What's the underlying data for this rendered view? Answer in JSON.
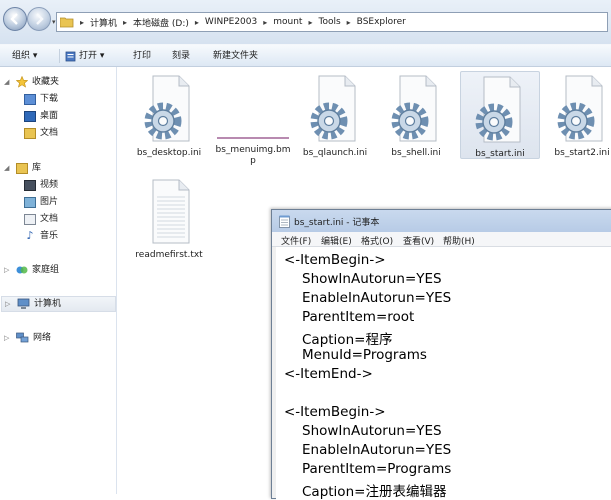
{
  "address": {
    "crumbs": [
      "计算机",
      "本地磁盘 (D:)",
      "WINPE2003",
      "mount",
      "Tools",
      "BSExplorer"
    ]
  },
  "toolbar": {
    "organize": "组织 ▾",
    "open": "打开 ▾",
    "print": "打印",
    "burn": "刻录",
    "new_folder": "新建文件夹"
  },
  "sidebar": {
    "favorites": "收藏夹",
    "downloads": "下载",
    "desktop": "桌面",
    "recent": "文档",
    "library": "库",
    "videos": "视频",
    "pictures": "图片",
    "documents": "文档",
    "music": "音乐",
    "homegroup": "家庭组",
    "computer": "计算机",
    "network": "网络"
  },
  "files": [
    "bs_desktop.ini",
    "bs_menuimg.bmp",
    "bs_qlaunch.ini",
    "bs_shell.ini",
    "bs_start.ini",
    "bs_start2.ini",
    "readmefirst.txt"
  ],
  "notepad": {
    "title": "bs_start.ini - 记事本",
    "menu": [
      "文件(F)",
      "编辑(E)",
      "格式(O)",
      "查看(V)",
      "帮助(H)"
    ],
    "lines": [
      "<-ItemBegin->",
      "ShowInAutorun=YES",
      "EnableInAutorun=YES",
      "ParentItem=root",
      "Caption=程序",
      "MenuId=Programs",
      "<-ItemEnd->",
      "",
      "<-ItemBegin->",
      "ShowInAutorun=YES",
      "EnableInAutorun=YES",
      "ParentItem=Programs",
      "Caption=注册表编辑器"
    ]
  }
}
